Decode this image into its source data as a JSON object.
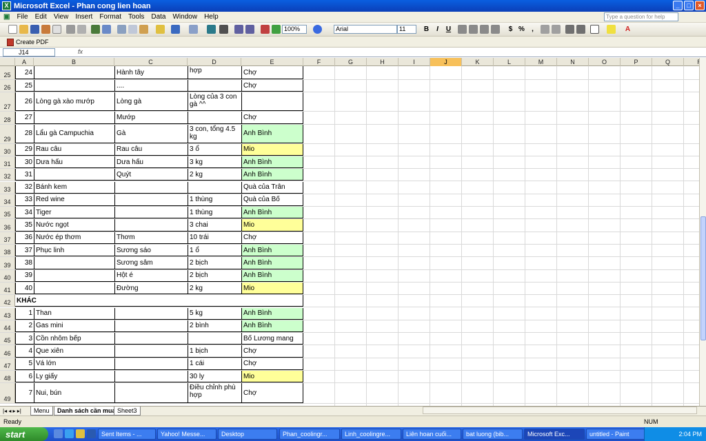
{
  "window": {
    "title": "Microsoft Excel - Phan cong lien hoan"
  },
  "menu": [
    "File",
    "Edit",
    "View",
    "Insert",
    "Format",
    "Tools",
    "Data",
    "Window",
    "Help"
  ],
  "help_box": {
    "placeholder": "Type a question for help"
  },
  "toolbar": {
    "zoom": "100%",
    "font": "Arial",
    "size": "11"
  },
  "pdf": {
    "label": "Create PDF"
  },
  "formula": {
    "name_box": "J14",
    "fx": "fx"
  },
  "columns": [
    "A",
    "B",
    "C",
    "D",
    "E",
    "F",
    "G",
    "H",
    "I",
    "J",
    "K",
    "L",
    "M",
    "N",
    "O",
    "P",
    "Q",
    "R"
  ],
  "selected_column": "J",
  "rows": [
    {
      "n": "25",
      "a": "24",
      "b": "",
      "c": "Hành tây",
      "d": "hợp",
      "e": "Chợ",
      "color": ""
    },
    {
      "n": "26",
      "a": "25",
      "b": "",
      "c": "....",
      "d": "",
      "e": "Chợ",
      "color": ""
    },
    {
      "n": "27",
      "a": "26",
      "b": "Lòng gà xào mướp",
      "c": "Lòng gà",
      "d": "Lòng của 3 con gà ^^",
      "e": "",
      "color": ""
    },
    {
      "n": "28",
      "a": "27",
      "b": "",
      "c": "Mướp",
      "d": "",
      "e": "Chợ",
      "color": ""
    },
    {
      "n": "29",
      "a": "28",
      "b": "Lẩu gà Campuchia",
      "c": "Gà",
      "d": "3 con, tổng 4.5 kg",
      "e": "Anh Bình",
      "color": "#ccffcc"
    },
    {
      "n": "30",
      "a": "29",
      "b": "Rau câu",
      "c": "Rau câu",
      "d": "3 ổ",
      "e": "Mio",
      "color": "#ffff99"
    },
    {
      "n": "31",
      "a": "30",
      "b": "Dưa hấu",
      "c": "Dưa hấu",
      "d": "3 kg",
      "e": "Anh Bình",
      "color": "#ccffcc"
    },
    {
      "n": "32",
      "a": "31",
      "b": "",
      "c": "Quýt",
      "d": "2 kg",
      "e": "Anh Bình",
      "color": "#ccffcc"
    },
    {
      "n": "33",
      "a": "32",
      "b": "Bánh kem",
      "c": "",
      "d": "",
      "e": "Quà của Trân",
      "color": ""
    },
    {
      "n": "34",
      "a": "33",
      "b": "Red wine",
      "c": "",
      "d": "1 thùng",
      "e": "Quà của Bố",
      "color": ""
    },
    {
      "n": "35",
      "a": "34",
      "b": "Tiger",
      "c": "",
      "d": "1 thùng",
      "e": "Anh Bình",
      "color": "#ccffcc"
    },
    {
      "n": "36",
      "a": "35",
      "b": "Nước ngọt",
      "c": "",
      "d": "3 chai",
      "e": "Mio",
      "color": "#ffff99"
    },
    {
      "n": "37",
      "a": "36",
      "b": "Nước ép thơm",
      "c": "Thơm",
      "d": "10 trái",
      "e": "Chợ",
      "color": ""
    },
    {
      "n": "38",
      "a": "37",
      "b": "Phục linh",
      "c": "Sương sáo",
      "d": "1 ổ",
      "e": "Anh Bình",
      "color": "#ccffcc"
    },
    {
      "n": "39",
      "a": "38",
      "b": "",
      "c": "Sương sâm",
      "d": "2 bịch",
      "e": "Anh Bình",
      "color": "#ccffcc"
    },
    {
      "n": "40",
      "a": "39",
      "b": "",
      "c": "Hột é",
      "d": "2 bịch",
      "e": "Anh Bình",
      "color": "#ccffcc"
    },
    {
      "n": "41",
      "a": "40",
      "b": "",
      "c": "Đường",
      "d": "2 kg",
      "e": "Mio",
      "color": "#ffff99"
    },
    {
      "n": "42",
      "a": "KHÁC",
      "b": "",
      "c": "",
      "d": "",
      "e": "",
      "color": "",
      "header": true
    },
    {
      "n": "43",
      "a": "1",
      "b": "Than",
      "c": "",
      "d": "5 kg",
      "e": "Anh Bình",
      "color": "#ccffcc"
    },
    {
      "n": "44",
      "a": "2",
      "b": "Gas mini",
      "c": "",
      "d": "2 bình",
      "e": "Anh Bình",
      "color": "#ccffcc"
    },
    {
      "n": "45",
      "a": "3",
      "b": "Cồn nhôm bếp",
      "c": "",
      "d": "",
      "e": "Bố Lương mang",
      "color": ""
    },
    {
      "n": "46",
      "a": "4",
      "b": "Que xiên",
      "c": "",
      "d": "1 bịch",
      "e": "Chợ",
      "color": ""
    },
    {
      "n": "47",
      "a": "5",
      "b": "Vá lớn",
      "c": "",
      "d": "1 cái",
      "e": "Chợ",
      "color": ""
    },
    {
      "n": "48",
      "a": "6",
      "b": "Ly giấy",
      "c": "",
      "d": "30 ly",
      "e": "Mio",
      "color": "#ffff99"
    },
    {
      "n": "49",
      "a": "7",
      "b": "Nui, bún",
      "c": "",
      "d": "Điều chỉnh phù hợp",
      "e": "Chợ",
      "color": ""
    }
  ],
  "sheets": [
    "Menu",
    "Danh sách cần mua",
    "Sheet3"
  ],
  "active_sheet": "Danh sách cần mua",
  "status": {
    "left": "Ready",
    "num": "NUM"
  },
  "taskbar": {
    "start": "start",
    "items": [
      "Sent Items - ...",
      "Yahoo! Messe...",
      "Desktop",
      "Phan_coolingr...",
      "Linh_coolingre...",
      "Liên hoan cuối...",
      "bat luong (bib...",
      "Microsoft Exc...",
      "untitled - Paint"
    ],
    "active": "Microsoft Exc...",
    "clock": "2:04 PM"
  }
}
